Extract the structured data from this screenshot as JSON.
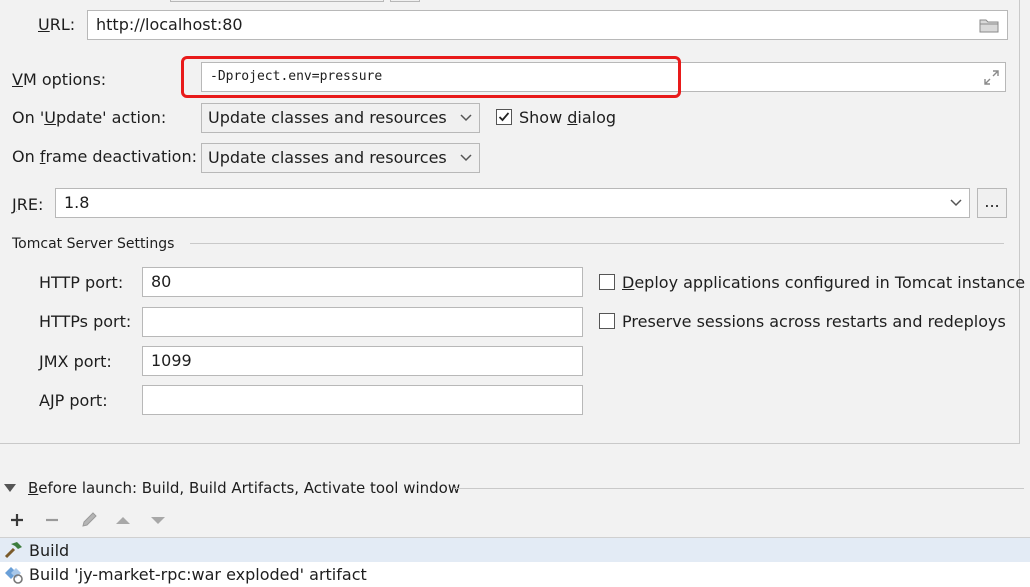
{
  "server": {
    "url_label": "URL:",
    "url_value": "http://localhost:80",
    "vm_label": "VM options:",
    "vm_value": "-Dproject.env=pressure",
    "update_label": "On 'Update' action:",
    "update_value": "Update classes and resources",
    "show_dialog_label": "Show dialog",
    "show_dialog_checked": true,
    "frame_label": "On frame deactivation:",
    "frame_value": "Update classes and resources",
    "jre_label": "JRE:",
    "jre_value": "1.8",
    "jre_browse": "..."
  },
  "tomcat": {
    "section_title": "Tomcat Server Settings",
    "http_label": "HTTP port:",
    "http_value": "80",
    "https_label": "HTTPs port:",
    "https_value": "",
    "jmx_label": "JMX port:",
    "jmx_value": "1099",
    "ajp_label": "AJP port:",
    "ajp_value": "",
    "deploy_label": "Deploy applications configured in Tomcat instance",
    "deploy_checked": false,
    "preserve_label": "Preserve sessions across restarts and redeploys",
    "preserve_checked": false
  },
  "before_launch": {
    "title": "Before launch: Build, Build Artifacts, Activate tool window",
    "items": [
      {
        "label": "Build",
        "icon": "hammer-icon"
      },
      {
        "label": "Build 'jy-market-rpc:war exploded' artifact",
        "icon": "artifact-icon"
      }
    ]
  },
  "colors": {
    "highlight": "#e81a1a",
    "selection": "#d6e4f5"
  }
}
